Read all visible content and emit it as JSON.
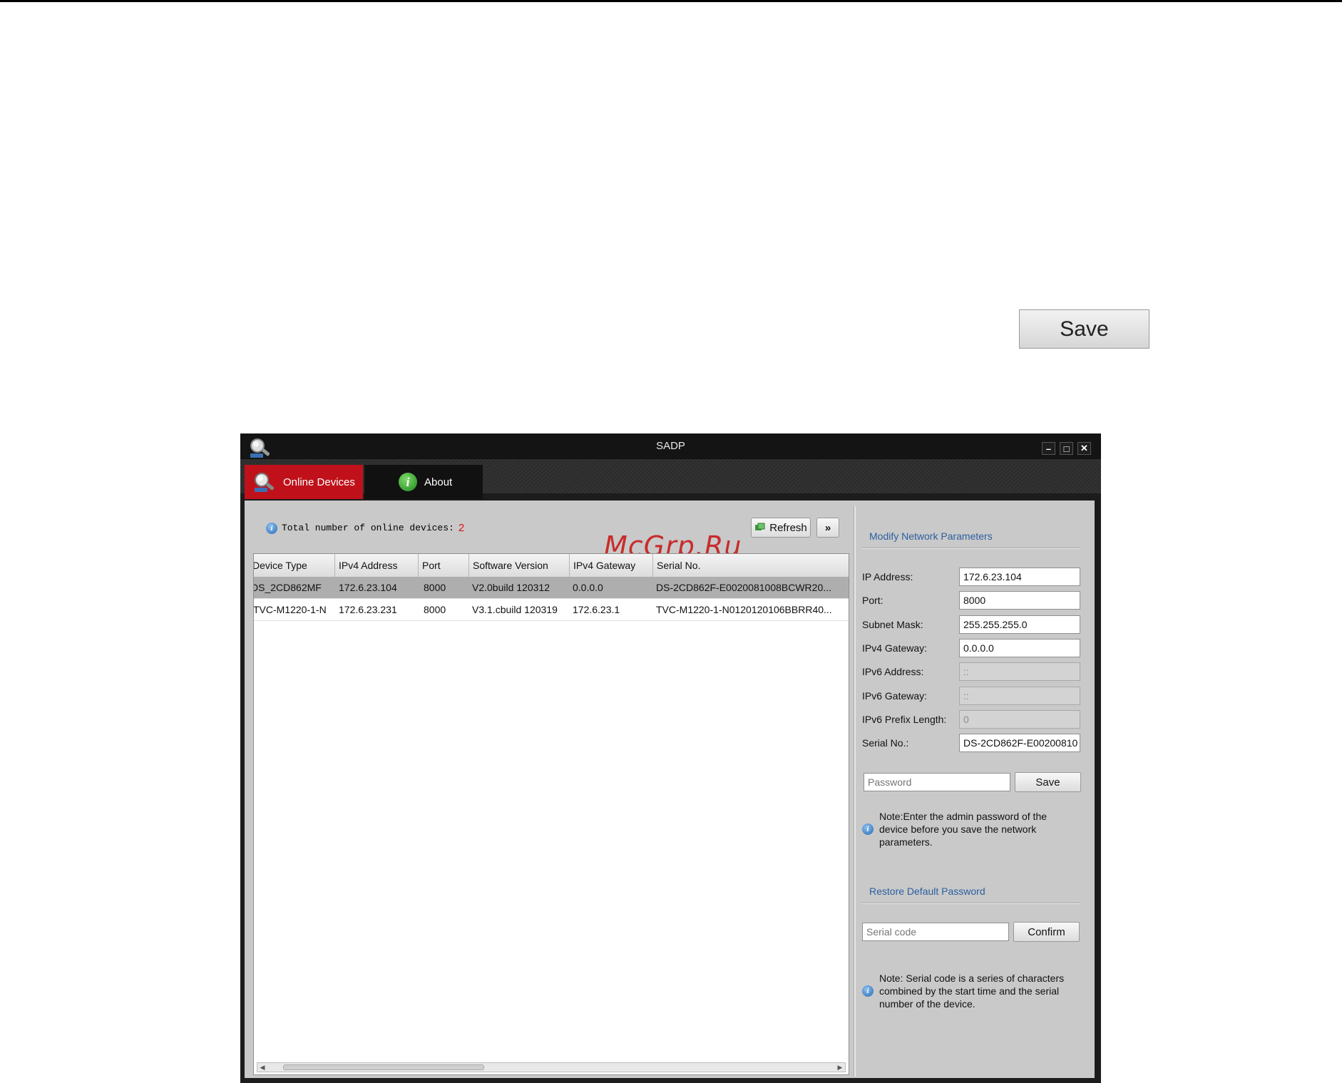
{
  "page": {
    "save_label": "Save",
    "watermark": "McGrp.Ru"
  },
  "window": {
    "title": "SADP",
    "controls": {
      "minimize": "–",
      "maximize": "□",
      "close": "✕"
    },
    "tabs": [
      {
        "label": "Online Devices",
        "icon": "search-icon",
        "active": true
      },
      {
        "label": "About",
        "icon": "info-icon",
        "active": false
      }
    ]
  },
  "devices": {
    "total_label": "Total number of online devices:",
    "total_count": "2",
    "refresh_label": "Refresh",
    "expand_label": "»",
    "columns": [
      "Device Type",
      "IPv4 Address",
      "Port",
      "Software Version",
      "IPv4 Gateway",
      "Serial No."
    ],
    "rows": [
      {
        "device_type": "DS_2CD862MF",
        "ipv4": "172.6.23.104",
        "port": "8000",
        "software": "V2.0build 120312",
        "gateway": "0.0.0.0",
        "serial": "DS-2CD862F-E0020081008BCWR20...",
        "selected": true
      },
      {
        "device_type": "TVC-M1220-1-N",
        "ipv4": "172.6.23.231",
        "port": "8000",
        "software": "V3.1.cbuild 120319",
        "gateway": "172.6.23.1",
        "serial": "TVC-M1220-1-N0120120106BBRR40...",
        "selected": false
      }
    ]
  },
  "modify": {
    "heading": "Modify Network Parameters",
    "fields": [
      {
        "label": "IP Address:",
        "value": "172.6.23.104",
        "disabled": false
      },
      {
        "label": "Port:",
        "value": "8000",
        "disabled": false
      },
      {
        "label": "Subnet Mask:",
        "value": "255.255.255.0",
        "disabled": false
      },
      {
        "label": "IPv4 Gateway:",
        "value": "0.0.0.0",
        "disabled": false
      },
      {
        "label": "IPv6 Address:",
        "value": "::",
        "disabled": true
      },
      {
        "label": "IPv6 Gateway:",
        "value": "::",
        "disabled": true
      },
      {
        "label": "IPv6 Prefix Length:",
        "value": "0",
        "disabled": true
      },
      {
        "label": "Serial No.:",
        "value": "DS-2CD862F-E00200810",
        "disabled": false
      }
    ],
    "password_placeholder": "Password",
    "save_label": "Save",
    "note_line1": "Note:Enter the admin password of the",
    "note_line2": "device before you save the network",
    "note_line3": "parameters."
  },
  "restore": {
    "heading": "Restore Default Password",
    "serial_placeholder": "Serial code",
    "confirm_label": "Confirm",
    "note_line1": "Note: Serial code is a series of characters",
    "note_line2": "combined by the start time and the serial",
    "note_line3": "number of the device."
  },
  "colors": {
    "active_tab": "#c0111a",
    "selected_row": "#aeaeae",
    "section_heading": "#2b5fa0",
    "device_count": "#e01010"
  }
}
